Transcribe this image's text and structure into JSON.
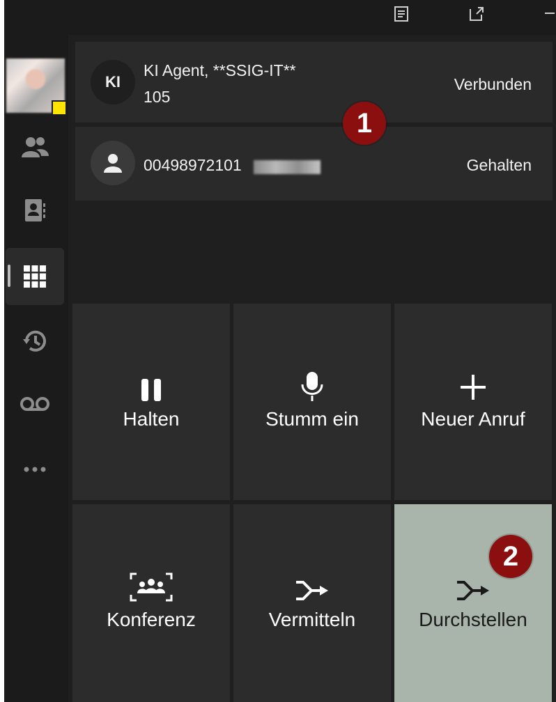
{
  "calls": [
    {
      "initials": "KI",
      "name": "KI Agent, **SSIG-IT**",
      "extension": "105",
      "status": "Verbunden"
    },
    {
      "number": "004989721​01",
      "status": "Gehalten"
    }
  ],
  "badges": {
    "first": "1",
    "second": "2"
  },
  "controls": {
    "hold": "Halten",
    "mute": "Stumm ein",
    "new_call": "Neuer Anruf",
    "conference": "Konferenz",
    "transfer": "Vermitteln",
    "consult_transfer": "Durchstellen"
  },
  "colors": {
    "badge": "#8b0f0f",
    "presence": "#ffe500",
    "highlight": "#a9b5ab"
  }
}
